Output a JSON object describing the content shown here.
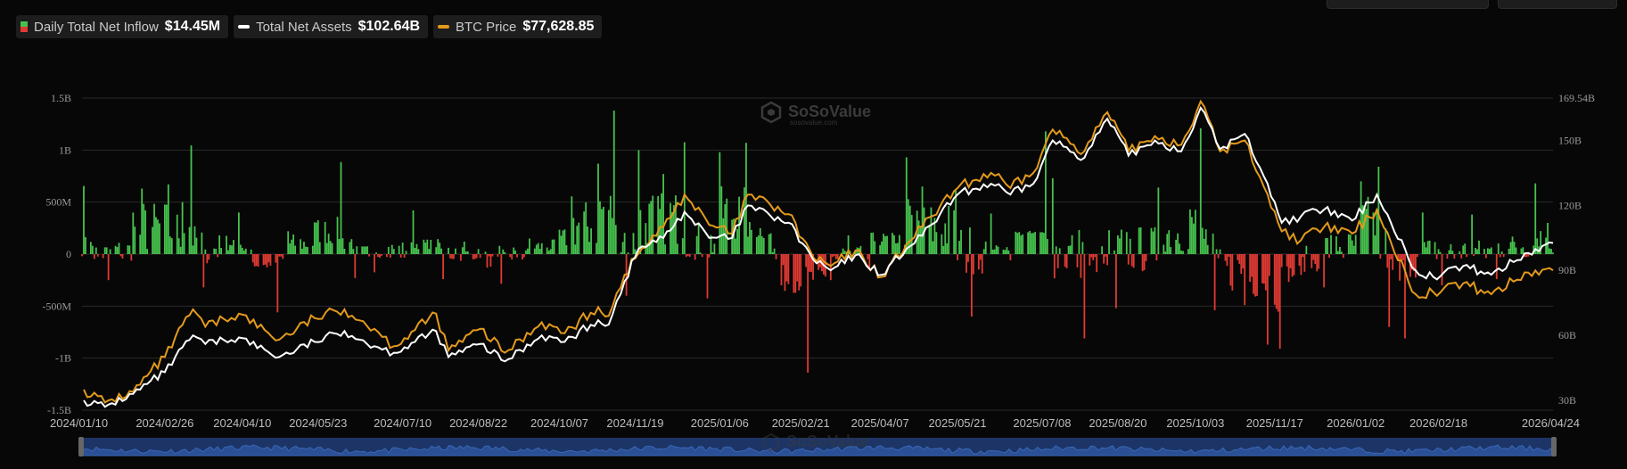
{
  "legend": {
    "inflow_label": "Daily Total Net Inflow",
    "inflow_value": "$14.45M",
    "assets_label": "Total Net Assets",
    "assets_value": "$102.64B",
    "btc_label": "BTC Price",
    "btc_value": "$77,628.85"
  },
  "watermark": {
    "brand": "SoSoValue",
    "sub": "sosovalue.com"
  },
  "colors": {
    "positive": "#46c24e",
    "negative": "#e03a33",
    "assets": "#ffffff",
    "btc": "#e39a1b",
    "grid": "#2a2a2a",
    "navigator": "#1c3566"
  },
  "chart_data": {
    "type": "bar+line",
    "x_range": [
      "2024/01/10",
      "2026/04/24"
    ],
    "x_ticks": [
      "2024/01/10",
      "2024/02/26",
      "2024/04/10",
      "2024/05/23",
      "2024/07/10",
      "2024/08/22",
      "2024/10/07",
      "2024/11/19",
      "2025/01/06",
      "2025/02/21",
      "2025/04/07",
      "2025/05/21",
      "2025/07/08",
      "2025/08/20",
      "2025/10/03",
      "2025/11/17",
      "2026/01/02",
      "2026/02/18",
      "2026/04/24"
    ],
    "y_left": {
      "label": "Daily Total Net Inflow",
      "ticks": [
        "1.5B",
        "1B",
        "500M",
        "0",
        "-500M",
        "-1B",
        "-1.5B"
      ],
      "range": [
        -1500,
        1500
      ],
      "unit": "M"
    },
    "y_right": {
      "label": "Total Net Assets",
      "ticks": [
        "169.54B",
        "150B",
        "120B",
        "90B",
        "60B",
        "30B"
      ],
      "range": [
        30,
        169.54
      ],
      "unit": "B"
    },
    "series": [
      {
        "name": "Daily Total Net Inflow",
        "kind": "bar",
        "keypoints": [
          [
            "2024/01/11",
            655
          ],
          [
            "2024/01/16",
            80
          ],
          [
            "2024/01/25",
            -250
          ],
          [
            "2024/02/08",
            400
          ],
          [
            "2024/02/13",
            630
          ],
          [
            "2024/02/28",
            670
          ],
          [
            "2024/03/07",
            500
          ],
          [
            "2024/03/12",
            1045
          ],
          [
            "2024/03/19",
            -320
          ],
          [
            "2024/03/28",
            180
          ],
          [
            "2024/04/08",
            400
          ],
          [
            "2024/04/16",
            -80
          ],
          [
            "2024/04/30",
            -560
          ],
          [
            "2024/05/06",
            220
          ],
          [
            "2024/05/21",
            305
          ],
          [
            "2024/06/05",
            885
          ],
          [
            "2024/06/13",
            -230
          ],
          [
            "2024/06/24",
            -175
          ],
          [
            "2024/07/16",
            420
          ],
          [
            "2024/07/31",
            110
          ],
          [
            "2024/08/02",
            -240
          ],
          [
            "2024/08/14",
            120
          ],
          [
            "2024/08/27",
            -130
          ],
          [
            "2024/09/04",
            -285
          ],
          [
            "2024/09/20",
            150
          ],
          [
            "2024/10/07",
            235
          ],
          [
            "2024/10/14",
            555
          ],
          [
            "2024/10/29",
            870
          ],
          [
            "2024/11/07",
            1380
          ],
          [
            "2024/11/14",
            -400
          ],
          [
            "2024/11/21",
            1000
          ],
          [
            "2024/12/05",
            770
          ],
          [
            "2024/12/17",
            1075
          ],
          [
            "2024/12/30",
            -425
          ],
          [
            "2025/01/06",
            980
          ],
          [
            "2025/01/21",
            1070
          ],
          [
            "2025/02/04",
            200
          ],
          [
            "2025/02/10",
            -300
          ],
          [
            "2025/02/25",
            -1140
          ],
          [
            "2025/03/10",
            -250
          ],
          [
            "2025/03/20",
            180
          ],
          [
            "2025/04/01",
            -150
          ],
          [
            "2025/04/22",
            930
          ],
          [
            "2025/05/01",
            650
          ],
          [
            "2025/05/20",
            610
          ],
          [
            "2025/05/29",
            -600
          ],
          [
            "2025/06/09",
            390
          ],
          [
            "2025/06/20",
            -60
          ],
          [
            "2025/07/10",
            1180
          ],
          [
            "2025/07/14",
            730
          ],
          [
            "2025/08/01",
            -810
          ],
          [
            "2025/08/15",
            230
          ],
          [
            "2025/08/19",
            -520
          ],
          [
            "2025/09/12",
            640
          ],
          [
            "2025/09/30",
            430
          ],
          [
            "2025/10/06",
            1210
          ],
          [
            "2025/10/14",
            -540
          ],
          [
            "2025/10/31",
            -490
          ],
          [
            "2025/11/13",
            -870
          ],
          [
            "2025/11/20",
            -910
          ],
          [
            "2025/12/02",
            -200
          ],
          [
            "2025/12/15",
            -320
          ],
          [
            "2026/01/05",
            700
          ],
          [
            "2026/01/15",
            840
          ],
          [
            "2026/01/21",
            -700
          ],
          [
            "2026/01/30",
            -810
          ],
          [
            "2026/02/09",
            400
          ],
          [
            "2026/02/20",
            -300
          ],
          [
            "2026/03/09",
            380
          ],
          [
            "2026/03/23",
            -240
          ],
          [
            "2026/04/14",
            680
          ],
          [
            "2026/04/21",
            300
          ],
          [
            "2026/04/24",
            14.45
          ]
        ]
      },
      {
        "name": "Total Net Assets",
        "kind": "line",
        "points": [
          [
            "2024/01/11",
            30
          ],
          [
            "2024/01/23",
            27
          ],
          [
            "2024/02/08",
            33
          ],
          [
            "2024/02/26",
            43
          ],
          [
            "2024/03/13",
            60
          ],
          [
            "2024/03/20",
            56
          ],
          [
            "2024/04/08",
            59
          ],
          [
            "2024/05/01",
            50
          ],
          [
            "2024/05/21",
            57
          ],
          [
            "2024/06/07",
            62
          ],
          [
            "2024/06/24",
            55
          ],
          [
            "2024/07/05",
            52
          ],
          [
            "2024/07/29",
            62
          ],
          [
            "2024/08/05",
            50
          ],
          [
            "2024/08/23",
            56
          ],
          [
            "2024/09/06",
            48
          ],
          [
            "2024/09/27",
            60
          ],
          [
            "2024/10/10",
            57
          ],
          [
            "2024/10/29",
            67
          ],
          [
            "2024/11/04",
            65
          ],
          [
            "2024/11/13",
            85
          ],
          [
            "2024/11/21",
            100
          ],
          [
            "2024/12/05",
            105
          ],
          [
            "2024/12/17",
            117
          ],
          [
            "2024/12/31",
            105
          ],
          [
            "2025/01/13",
            105
          ],
          [
            "2025/01/22",
            120
          ],
          [
            "2025/02/04",
            115
          ],
          [
            "2025/02/14",
            112
          ],
          [
            "2025/02/28",
            95
          ],
          [
            "2025/03/10",
            90
          ],
          [
            "2025/03/24",
            97
          ],
          [
            "2025/04/08",
            88
          ],
          [
            "2025/04/22",
            100
          ],
          [
            "2025/05/01",
            106
          ],
          [
            "2025/05/21",
            125
          ],
          [
            "2025/06/09",
            130
          ],
          [
            "2025/06/20",
            125
          ],
          [
            "2025/07/03",
            130
          ],
          [
            "2025/07/14",
            150
          ],
          [
            "2025/08/01",
            142
          ],
          [
            "2025/08/14",
            160
          ],
          [
            "2025/08/26",
            143
          ],
          [
            "2025/09/10",
            150
          ],
          [
            "2025/09/25",
            145
          ],
          [
            "2025/10/06",
            165
          ],
          [
            "2025/10/17",
            146
          ],
          [
            "2025/10/31",
            153
          ],
          [
            "2025/11/13",
            130
          ],
          [
            "2025/11/21",
            112
          ],
          [
            "2025/12/02",
            115
          ],
          [
            "2025/12/15",
            118
          ],
          [
            "2025/12/31",
            113
          ],
          [
            "2026/01/14",
            125
          ],
          [
            "2026/01/22",
            112
          ],
          [
            "2026/02/05",
            90
          ],
          [
            "2026/02/15",
            87
          ],
          [
            "2026/03/04",
            92
          ],
          [
            "2026/03/20",
            88
          ],
          [
            "2026/04/10",
            98
          ],
          [
            "2026/04/24",
            102.64
          ]
        ]
      },
      {
        "name": "BTC Price",
        "kind": "line",
        "points": [
          [
            "2024/01/11",
            35
          ],
          [
            "2024/01/23",
            29
          ],
          [
            "2024/02/08",
            34
          ],
          [
            "2024/02/26",
            50
          ],
          [
            "2024/03/13",
            72
          ],
          [
            "2024/03/20",
            64
          ],
          [
            "2024/04/08",
            70
          ],
          [
            "2024/05/01",
            58
          ],
          [
            "2024/05/21",
            68
          ],
          [
            "2024/06/07",
            72
          ],
          [
            "2024/06/24",
            63
          ],
          [
            "2024/07/05",
            55
          ],
          [
            "2024/07/29",
            70
          ],
          [
            "2024/08/05",
            53
          ],
          [
            "2024/08/23",
            63
          ],
          [
            "2024/09/06",
            52
          ],
          [
            "2024/09/27",
            66
          ],
          [
            "2024/10/10",
            61
          ],
          [
            "2024/10/29",
            73
          ],
          [
            "2024/11/04",
            69
          ],
          [
            "2024/11/13",
            88
          ],
          [
            "2024/11/21",
            98
          ],
          [
            "2024/12/05",
            110
          ],
          [
            "2024/12/17",
            125
          ],
          [
            "2024/12/31",
            111
          ],
          [
            "2025/01/13",
            107
          ],
          [
            "2025/01/22",
            125
          ],
          [
            "2025/02/04",
            120
          ],
          [
            "2025/02/14",
            116
          ],
          [
            "2025/02/28",
            96
          ],
          [
            "2025/03/10",
            92
          ],
          [
            "2025/03/24",
            99
          ],
          [
            "2025/04/08",
            87
          ],
          [
            "2025/04/22",
            102
          ],
          [
            "2025/05/01",
            110
          ],
          [
            "2025/05/21",
            128
          ],
          [
            "2025/06/09",
            135
          ],
          [
            "2025/06/20",
            128
          ],
          [
            "2025/07/03",
            135
          ],
          [
            "2025/07/14",
            155
          ],
          [
            "2025/08/01",
            145
          ],
          [
            "2025/08/14",
            163
          ],
          [
            "2025/08/26",
            145
          ],
          [
            "2025/09/10",
            152
          ],
          [
            "2025/09/25",
            148
          ],
          [
            "2025/10/06",
            168
          ],
          [
            "2025/10/17",
            145
          ],
          [
            "2025/10/31",
            150
          ],
          [
            "2025/11/13",
            125
          ],
          [
            "2025/11/21",
            108
          ],
          [
            "2025/12/02",
            104
          ],
          [
            "2025/12/15",
            110
          ],
          [
            "2025/12/31",
            107
          ],
          [
            "2026/01/14",
            118
          ],
          [
            "2026/01/22",
            103
          ],
          [
            "2026/02/05",
            79
          ],
          [
            "2026/02/15",
            80
          ],
          [
            "2026/03/04",
            84
          ],
          [
            "2026/03/20",
            79
          ],
          [
            "2026/04/10",
            89
          ],
          [
            "2026/04/24",
            90
          ]
        ]
      }
    ],
    "grid": true,
    "legend_position": "top-left",
    "navigator": true
  }
}
